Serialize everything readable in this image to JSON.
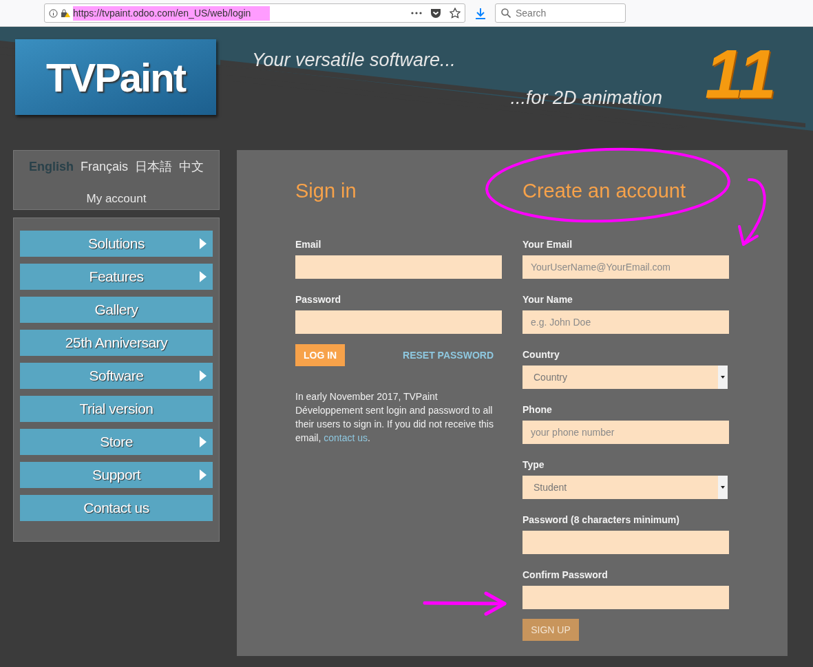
{
  "browser": {
    "url": "https://tvpaint.odoo.com/en_US/web/login",
    "url_highlighted": true,
    "search_placeholder": "Search"
  },
  "header": {
    "logo": "TVPaint",
    "tagline_1": "Your versatile software...",
    "tagline_2": "...for 2D animation",
    "version": "11"
  },
  "languages": [
    {
      "label": "English",
      "selected": true
    },
    {
      "label": "Français",
      "selected": false
    },
    {
      "label": "日本語",
      "selected": false
    },
    {
      "label": "中文",
      "selected": false
    }
  ],
  "my_account": "My account",
  "menu": [
    {
      "label": "Solutions",
      "has_submenu": true
    },
    {
      "label": "Features",
      "has_submenu": true
    },
    {
      "label": "Gallery",
      "has_submenu": false
    },
    {
      "label": "25th Anniversary",
      "has_submenu": false
    },
    {
      "label": "Software",
      "has_submenu": true
    },
    {
      "label": "Trial version",
      "has_submenu": false
    },
    {
      "label": "Store",
      "has_submenu": true
    },
    {
      "label": "Support",
      "has_submenu": true
    },
    {
      "label": "Contact us",
      "has_submenu": false
    }
  ],
  "sign_in": {
    "title": "Sign in",
    "fields": [
      {
        "label": "Email"
      },
      {
        "label": "Password"
      }
    ],
    "login_button": "LOG IN",
    "reset_link": "RESET PASSWORD",
    "note_before": "In early November 2017, TVPaint Développement sent login and password to all their users to sign in. If you did not receive this email, ",
    "note_link": "contact us",
    "note_after": "."
  },
  "create_account": {
    "title": "Create an account",
    "title_circled": true,
    "fields": [
      {
        "kind": "input",
        "label": "Your Email",
        "placeholder": "YourUserName@YourEmail.com"
      },
      {
        "kind": "input",
        "label": "Your Name",
        "placeholder": "e.g. John Doe"
      },
      {
        "kind": "select",
        "label": "Country",
        "value": "Country"
      },
      {
        "kind": "input",
        "label": "Phone",
        "placeholder": "your phone number"
      },
      {
        "kind": "select",
        "label": "Type",
        "value": "Student"
      },
      {
        "kind": "input",
        "label": "Password (8 characters minimum)"
      },
      {
        "kind": "input",
        "label": "Confirm Password"
      }
    ],
    "signup_button": "SIGN UP",
    "signup_arrow": true
  }
}
